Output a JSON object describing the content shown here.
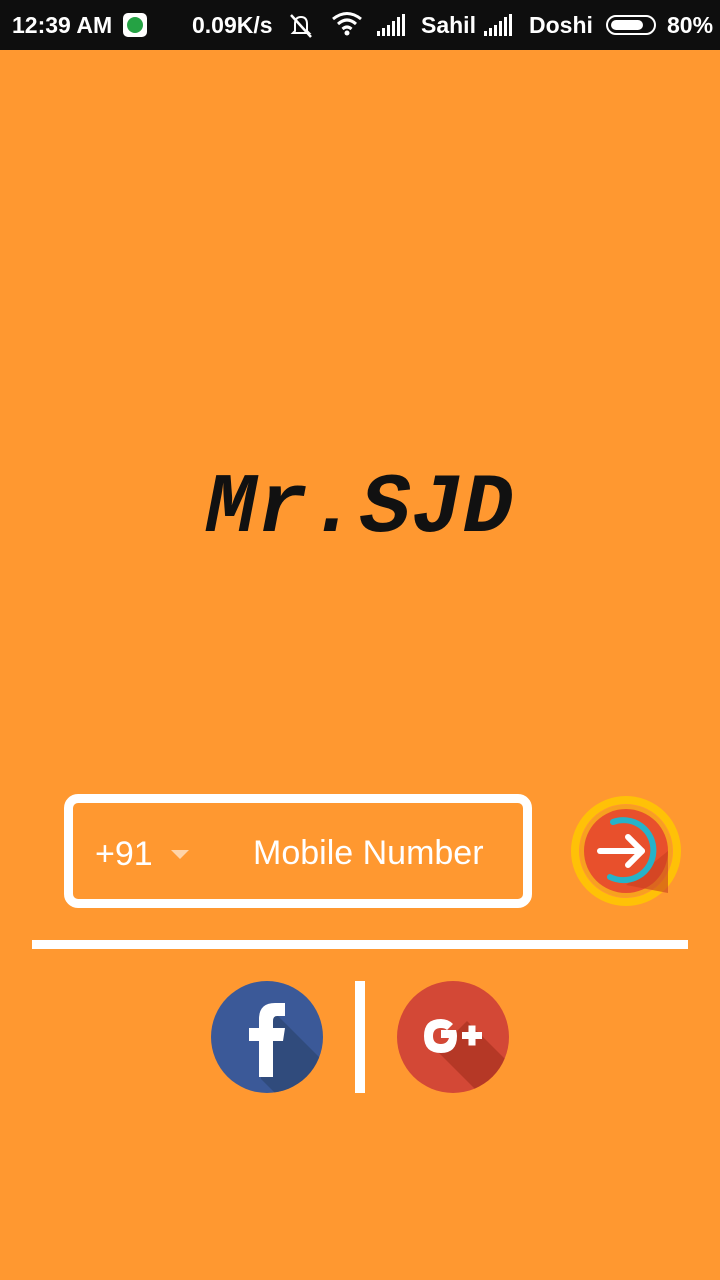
{
  "status_bar": {
    "time": "12:39 AM",
    "net_speed": "0.09K/s",
    "carrier_1": "Sahil",
    "carrier_2": "Doshi",
    "battery_percent": "80%",
    "battery_level": 0.8,
    "icons": [
      "whatsapp-icon",
      "mute-icon",
      "wifi-icon",
      "signal-icon",
      "signal-icon",
      "battery-icon"
    ]
  },
  "app": {
    "logo_text": "Mr.SJD"
  },
  "login": {
    "country_code": "+91",
    "mobile_placeholder": "Mobile Number",
    "mobile_value": ""
  },
  "social": {
    "facebook_icon": "facebook-icon",
    "google_plus_icon": "google-plus-icon"
  },
  "colors": {
    "background": "#FF9830",
    "status_bar": "#0E0E0E",
    "facebook": "#3B5998",
    "google_plus": "#D34836",
    "submit_ring": "#FFC107",
    "submit_inner": "#E8502C",
    "submit_arc": "#26B3C9"
  }
}
